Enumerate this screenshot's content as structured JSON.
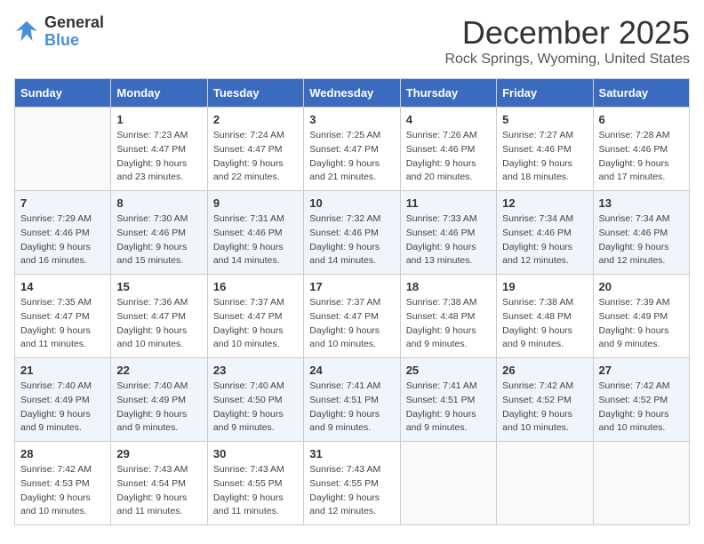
{
  "logo": {
    "general": "General",
    "blue": "Blue"
  },
  "title": "December 2025",
  "location": "Rock Springs, Wyoming, United States",
  "days_header": [
    "Sunday",
    "Monday",
    "Tuesday",
    "Wednesday",
    "Thursday",
    "Friday",
    "Saturday"
  ],
  "weeks": [
    [
      {
        "day": "",
        "sunrise": "",
        "sunset": "",
        "daylight": ""
      },
      {
        "day": "1",
        "sunrise": "Sunrise: 7:23 AM",
        "sunset": "Sunset: 4:47 PM",
        "daylight": "Daylight: 9 hours and 23 minutes."
      },
      {
        "day": "2",
        "sunrise": "Sunrise: 7:24 AM",
        "sunset": "Sunset: 4:47 PM",
        "daylight": "Daylight: 9 hours and 22 minutes."
      },
      {
        "day": "3",
        "sunrise": "Sunrise: 7:25 AM",
        "sunset": "Sunset: 4:47 PM",
        "daylight": "Daylight: 9 hours and 21 minutes."
      },
      {
        "day": "4",
        "sunrise": "Sunrise: 7:26 AM",
        "sunset": "Sunset: 4:46 PM",
        "daylight": "Daylight: 9 hours and 20 minutes."
      },
      {
        "day": "5",
        "sunrise": "Sunrise: 7:27 AM",
        "sunset": "Sunset: 4:46 PM",
        "daylight": "Daylight: 9 hours and 18 minutes."
      },
      {
        "day": "6",
        "sunrise": "Sunrise: 7:28 AM",
        "sunset": "Sunset: 4:46 PM",
        "daylight": "Daylight: 9 hours and 17 minutes."
      }
    ],
    [
      {
        "day": "7",
        "sunrise": "Sunrise: 7:29 AM",
        "sunset": "Sunset: 4:46 PM",
        "daylight": "Daylight: 9 hours and 16 minutes."
      },
      {
        "day": "8",
        "sunrise": "Sunrise: 7:30 AM",
        "sunset": "Sunset: 4:46 PM",
        "daylight": "Daylight: 9 hours and 15 minutes."
      },
      {
        "day": "9",
        "sunrise": "Sunrise: 7:31 AM",
        "sunset": "Sunset: 4:46 PM",
        "daylight": "Daylight: 9 hours and 14 minutes."
      },
      {
        "day": "10",
        "sunrise": "Sunrise: 7:32 AM",
        "sunset": "Sunset: 4:46 PM",
        "daylight": "Daylight: 9 hours and 14 minutes."
      },
      {
        "day": "11",
        "sunrise": "Sunrise: 7:33 AM",
        "sunset": "Sunset: 4:46 PM",
        "daylight": "Daylight: 9 hours and 13 minutes."
      },
      {
        "day": "12",
        "sunrise": "Sunrise: 7:34 AM",
        "sunset": "Sunset: 4:46 PM",
        "daylight": "Daylight: 9 hours and 12 minutes."
      },
      {
        "day": "13",
        "sunrise": "Sunrise: 7:34 AM",
        "sunset": "Sunset: 4:46 PM",
        "daylight": "Daylight: 9 hours and 12 minutes."
      }
    ],
    [
      {
        "day": "14",
        "sunrise": "Sunrise: 7:35 AM",
        "sunset": "Sunset: 4:47 PM",
        "daylight": "Daylight: 9 hours and 11 minutes."
      },
      {
        "day": "15",
        "sunrise": "Sunrise: 7:36 AM",
        "sunset": "Sunset: 4:47 PM",
        "daylight": "Daylight: 9 hours and 10 minutes."
      },
      {
        "day": "16",
        "sunrise": "Sunrise: 7:37 AM",
        "sunset": "Sunset: 4:47 PM",
        "daylight": "Daylight: 9 hours and 10 minutes."
      },
      {
        "day": "17",
        "sunrise": "Sunrise: 7:37 AM",
        "sunset": "Sunset: 4:47 PM",
        "daylight": "Daylight: 9 hours and 10 minutes."
      },
      {
        "day": "18",
        "sunrise": "Sunrise: 7:38 AM",
        "sunset": "Sunset: 4:48 PM",
        "daylight": "Daylight: 9 hours and 9 minutes."
      },
      {
        "day": "19",
        "sunrise": "Sunrise: 7:38 AM",
        "sunset": "Sunset: 4:48 PM",
        "daylight": "Daylight: 9 hours and 9 minutes."
      },
      {
        "day": "20",
        "sunrise": "Sunrise: 7:39 AM",
        "sunset": "Sunset: 4:49 PM",
        "daylight": "Daylight: 9 hours and 9 minutes."
      }
    ],
    [
      {
        "day": "21",
        "sunrise": "Sunrise: 7:40 AM",
        "sunset": "Sunset: 4:49 PM",
        "daylight": "Daylight: 9 hours and 9 minutes."
      },
      {
        "day": "22",
        "sunrise": "Sunrise: 7:40 AM",
        "sunset": "Sunset: 4:49 PM",
        "daylight": "Daylight: 9 hours and 9 minutes."
      },
      {
        "day": "23",
        "sunrise": "Sunrise: 7:40 AM",
        "sunset": "Sunset: 4:50 PM",
        "daylight": "Daylight: 9 hours and 9 minutes."
      },
      {
        "day": "24",
        "sunrise": "Sunrise: 7:41 AM",
        "sunset": "Sunset: 4:51 PM",
        "daylight": "Daylight: 9 hours and 9 minutes."
      },
      {
        "day": "25",
        "sunrise": "Sunrise: 7:41 AM",
        "sunset": "Sunset: 4:51 PM",
        "daylight": "Daylight: 9 hours and 9 minutes."
      },
      {
        "day": "26",
        "sunrise": "Sunrise: 7:42 AM",
        "sunset": "Sunset: 4:52 PM",
        "daylight": "Daylight: 9 hours and 10 minutes."
      },
      {
        "day": "27",
        "sunrise": "Sunrise: 7:42 AM",
        "sunset": "Sunset: 4:52 PM",
        "daylight": "Daylight: 9 hours and 10 minutes."
      }
    ],
    [
      {
        "day": "28",
        "sunrise": "Sunrise: 7:42 AM",
        "sunset": "Sunset: 4:53 PM",
        "daylight": "Daylight: 9 hours and 10 minutes."
      },
      {
        "day": "29",
        "sunrise": "Sunrise: 7:43 AM",
        "sunset": "Sunset: 4:54 PM",
        "daylight": "Daylight: 9 hours and 11 minutes."
      },
      {
        "day": "30",
        "sunrise": "Sunrise: 7:43 AM",
        "sunset": "Sunset: 4:55 PM",
        "daylight": "Daylight: 9 hours and 11 minutes."
      },
      {
        "day": "31",
        "sunrise": "Sunrise: 7:43 AM",
        "sunset": "Sunset: 4:55 PM",
        "daylight": "Daylight: 9 hours and 12 minutes."
      },
      {
        "day": "",
        "sunrise": "",
        "sunset": "",
        "daylight": ""
      },
      {
        "day": "",
        "sunrise": "",
        "sunset": "",
        "daylight": ""
      },
      {
        "day": "",
        "sunrise": "",
        "sunset": "",
        "daylight": ""
      }
    ]
  ]
}
